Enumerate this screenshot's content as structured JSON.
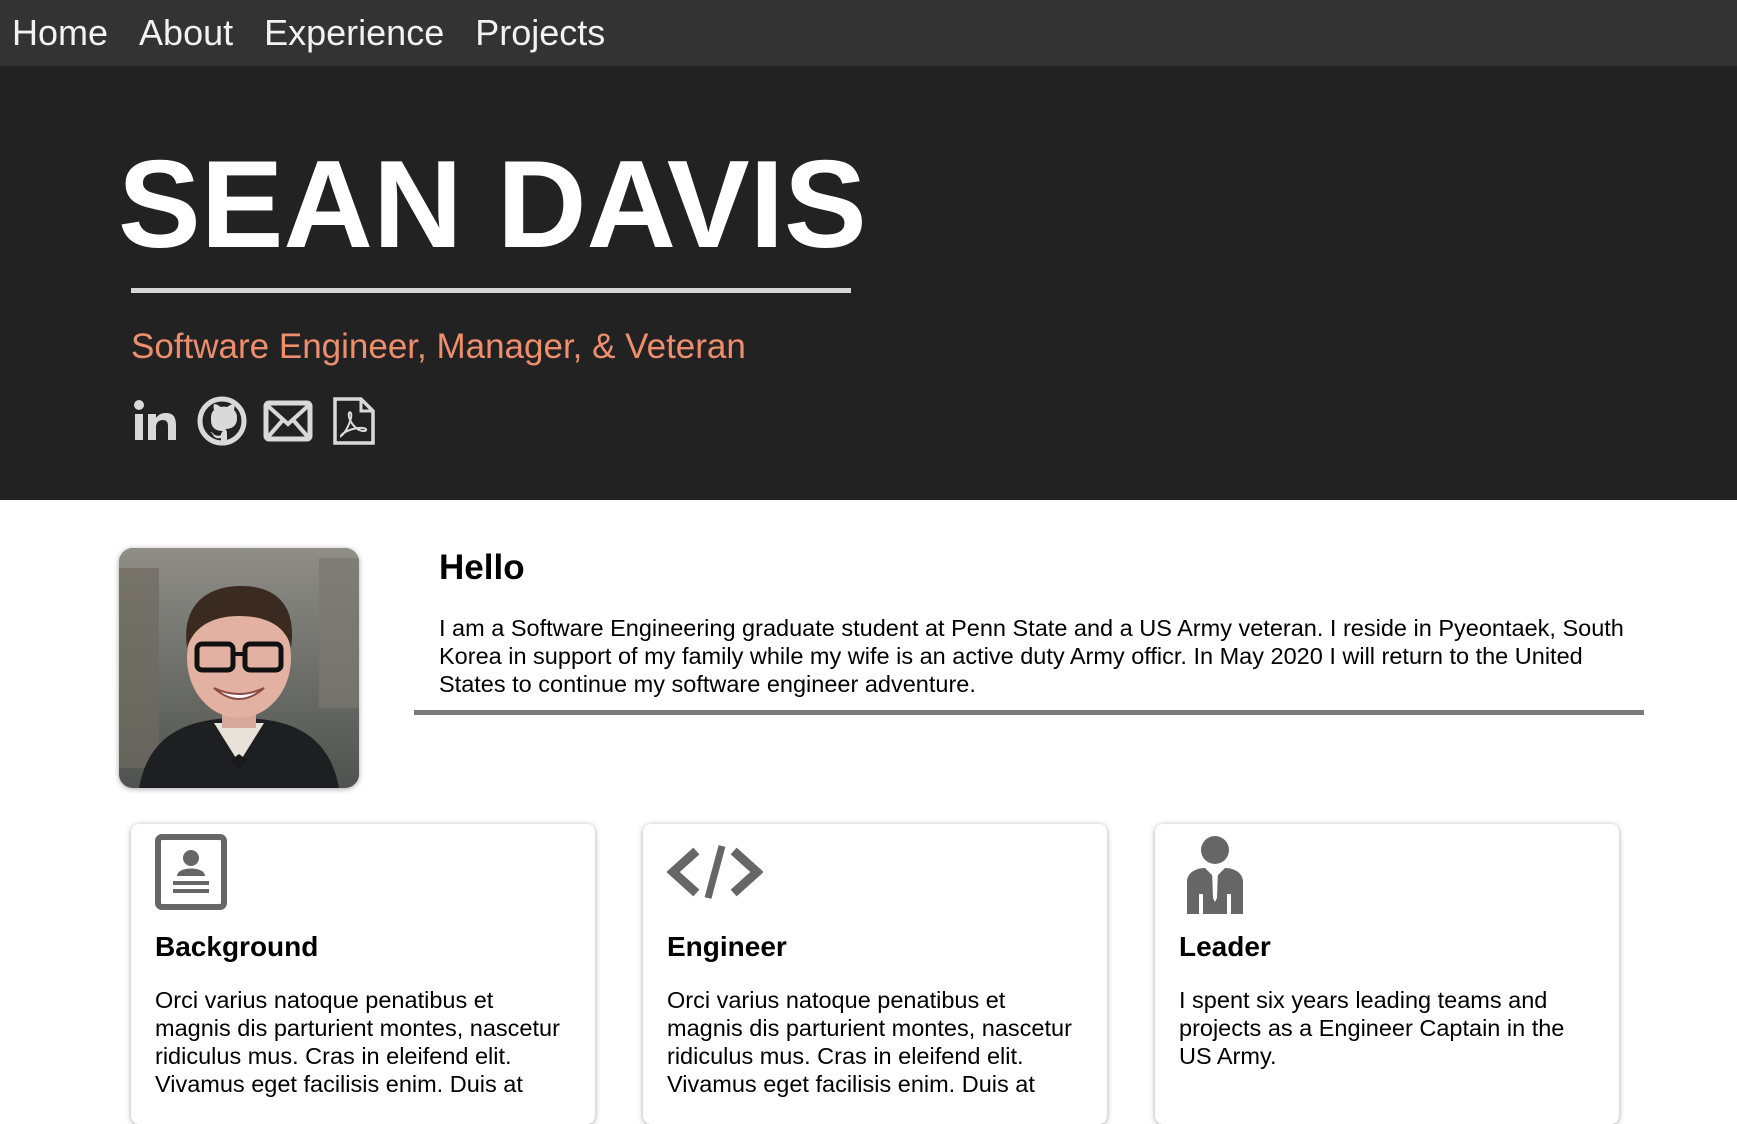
{
  "nav": {
    "items": [
      {
        "label": "Home"
      },
      {
        "label": "About"
      },
      {
        "label": "Experience"
      },
      {
        "label": "Projects"
      }
    ]
  },
  "hero": {
    "name": "SEAN DAVIS",
    "tagline": "Software Engineer, Manager, & Veteran",
    "social": [
      {
        "icon": "linkedin-icon"
      },
      {
        "icon": "github-icon"
      },
      {
        "icon": "email-icon"
      },
      {
        "icon": "pdf-resume-icon"
      }
    ]
  },
  "about": {
    "title": "Hello",
    "text": "I am a Software Engineering graduate student at Penn State and a US Army veteran. I reside in Pyeontaek, South Korea in support of my family while my wife is an active duty Army officr. In May 2020 I will return to the United States to continue my software engineer adventure."
  },
  "cards": [
    {
      "icon": "contact-card-icon",
      "title": "Background",
      "text": "Orci varius natoque penatibus et magnis dis parturient montes, nascetur ridiculus mus. Cras in eleifend elit. Vivamus eget facilisis enim. Duis at"
    },
    {
      "icon": "code-icon",
      "title": "Engineer",
      "text": "Orci varius natoque penatibus et magnis dis parturient montes, nascetur ridiculus mus. Cras in eleifend elit. Vivamus eget facilisis enim. Duis at"
    },
    {
      "icon": "businessman-icon",
      "title": "Leader",
      "text": "I spent six years leading teams and projects as a Engineer Captain in the US Army."
    }
  ],
  "colors": {
    "nav_bg": "#333333",
    "hero_bg": "#222222",
    "tagline": "#ee8e6d",
    "icon_gray": "#d9d9d9",
    "card_icon_gray": "#666666"
  }
}
